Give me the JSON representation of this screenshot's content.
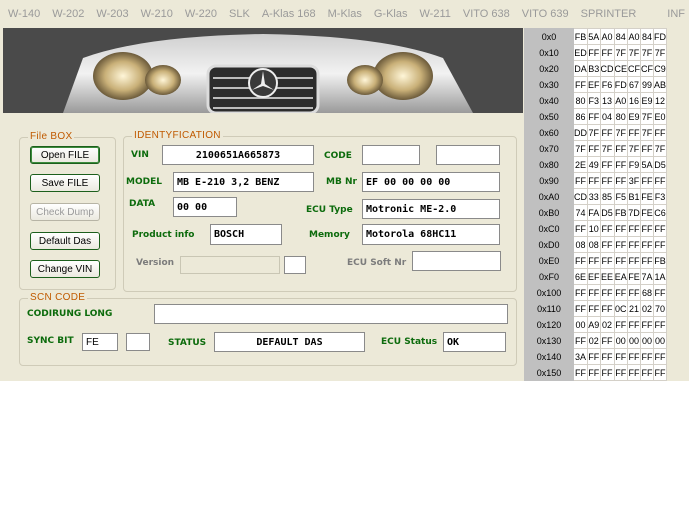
{
  "tabs": [
    "W-140",
    "W-202",
    "W-203",
    "W-210",
    "W-220",
    "SLK",
    "A-Klas 168",
    "M-Klas",
    "G-Klas",
    "W-211",
    "VITO 638",
    "VITO 639",
    "SPRINTER",
    "INF"
  ],
  "photo": {
    "subject": "car-front-grille"
  },
  "filebox": {
    "title": "File BOX",
    "buttons": [
      "Open FILE",
      "Save FILE",
      "Check Dump",
      "Default Das",
      "Change VIN"
    ]
  },
  "ident": {
    "title": "IDENTYFICATION",
    "vin_label": "VIN",
    "vin": "2100651A665873",
    "code_label": "CODE",
    "code1": "",
    "code2": "",
    "model_label": "MODEL",
    "model": "MB E-210 3,2 BENZ",
    "mbnr_label": "MB Nr",
    "mbnr": "EF 00 00 00 00",
    "data_label": "DATA",
    "data": "00 00",
    "ecutype_label": "ECU Type",
    "ecutype": "Motronic ME-2.0",
    "product_label": "Product info",
    "product": "BOSCH",
    "memory_label": "Memory",
    "memory": "Motorola 68HC11",
    "version_label": "Version",
    "version": "",
    "version2": "",
    "ecusoft_label": "ECU Soft Nr",
    "ecusoft": ""
  },
  "scn": {
    "title": "SCN CODE",
    "codirung_label": "CODIRUNG LONG",
    "codirung": "",
    "sync_label": "SYNC BIT",
    "sync1": "FE",
    "sync2": "",
    "status_label": "STATUS",
    "status": "DEFAULT DAS",
    "ecustatus_label": "ECU Status",
    "ecustatus": "OK"
  },
  "hex_rows": [
    {
      "addr": "0x0",
      "bytes": [
        "FB",
        "5A",
        "A0",
        "84",
        "A0",
        "84",
        "FD"
      ]
    },
    {
      "addr": "0x10",
      "bytes": [
        "ED",
        "FF",
        "FF",
        "7F",
        "7F",
        "7F",
        "7F"
      ]
    },
    {
      "addr": "0x20",
      "bytes": [
        "DA",
        "B3",
        "CD",
        "CE",
        "CF",
        "CF",
        "C9"
      ]
    },
    {
      "addr": "0x30",
      "bytes": [
        "FF",
        "EF",
        "F6",
        "FD",
        "67",
        "99",
        "AB"
      ]
    },
    {
      "addr": "0x40",
      "bytes": [
        "80",
        "F3",
        "13",
        "A0",
        "16",
        "E9",
        "12"
      ]
    },
    {
      "addr": "0x50",
      "bytes": [
        "86",
        "FF",
        "04",
        "80",
        "E9",
        "7F",
        "E0"
      ]
    },
    {
      "addr": "0x60",
      "bytes": [
        "DD",
        "7F",
        "FF",
        "7F",
        "FF",
        "7F",
        "FF"
      ]
    },
    {
      "addr": "0x70",
      "bytes": [
        "7F",
        "FF",
        "7F",
        "FF",
        "7F",
        "FF",
        "7F"
      ]
    },
    {
      "addr": "0x80",
      "bytes": [
        "2E",
        "49",
        "FF",
        "FF",
        "F9",
        "5A",
        "D5"
      ]
    },
    {
      "addr": "0x90",
      "bytes": [
        "FF",
        "FF",
        "FF",
        "FF",
        "3F",
        "FF",
        "FF"
      ]
    },
    {
      "addr": "0xA0",
      "bytes": [
        "CD",
        "33",
        "85",
        "F5",
        "B1",
        "FE",
        "F3"
      ]
    },
    {
      "addr": "0xB0",
      "bytes": [
        "74",
        "FA",
        "D5",
        "FB",
        "7D",
        "FE",
        "C6"
      ]
    },
    {
      "addr": "0xC0",
      "bytes": [
        "FF",
        "10",
        "FF",
        "FF",
        "FF",
        "FF",
        "FF"
      ]
    },
    {
      "addr": "0xD0",
      "bytes": [
        "08",
        "08",
        "FF",
        "FF",
        "FF",
        "FF",
        "FF"
      ]
    },
    {
      "addr": "0xE0",
      "bytes": [
        "FF",
        "FF",
        "FF",
        "FF",
        "FF",
        "FF",
        "FB"
      ]
    },
    {
      "addr": "0xF0",
      "bytes": [
        "6E",
        "EF",
        "EE",
        "EA",
        "FE",
        "7A",
        "1A"
      ]
    },
    {
      "addr": "0x100",
      "bytes": [
        "FF",
        "FF",
        "FF",
        "FF",
        "FF",
        "68",
        "FF"
      ]
    },
    {
      "addr": "0x110",
      "bytes": [
        "FF",
        "FF",
        "FF",
        "0C",
        "21",
        "02",
        "70"
      ]
    },
    {
      "addr": "0x120",
      "bytes": [
        "00",
        "A9",
        "02",
        "FF",
        "FF",
        "FF",
        "FF"
      ]
    },
    {
      "addr": "0x130",
      "bytes": [
        "FF",
        "02",
        "FF",
        "00",
        "00",
        "00",
        "00"
      ]
    },
    {
      "addr": "0x140",
      "bytes": [
        "3A",
        "FF",
        "FF",
        "FF",
        "FF",
        "FF",
        "FF"
      ]
    },
    {
      "addr": "0x150",
      "bytes": [
        "FF",
        "FF",
        "FF",
        "FF",
        "FF",
        "FF",
        "FF"
      ]
    }
  ]
}
